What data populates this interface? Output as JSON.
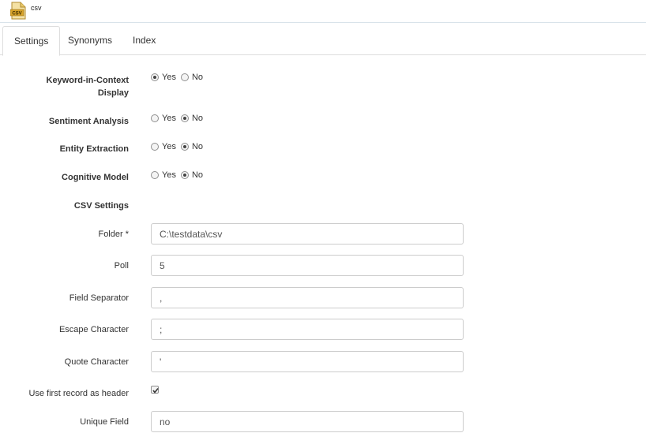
{
  "header": {
    "title": "csv",
    "icon": "csv-file-icon",
    "icon_label": "CSV"
  },
  "tabs": [
    {
      "label": "Settings",
      "active": true
    },
    {
      "label": "Synonyms",
      "active": false
    },
    {
      "label": "Index",
      "active": false
    }
  ],
  "options": {
    "yes_label": "Yes",
    "no_label": "No",
    "keyword_in_context": {
      "label_line1": "Keyword-in-Context",
      "label_line2": "Display",
      "value": "Yes"
    },
    "sentiment_analysis": {
      "label": "Sentiment Analysis",
      "value": "No"
    },
    "entity_extraction": {
      "label": "Entity Extraction",
      "value": "No"
    },
    "cognitive_model": {
      "label": "Cognitive Model",
      "value": "No"
    }
  },
  "csv_settings": {
    "heading": "CSV Settings",
    "folder": {
      "label": "Folder *",
      "value": "C:\\testdata\\csv"
    },
    "poll": {
      "label": "Poll",
      "value": "5"
    },
    "field_separator": {
      "label": "Field Separator",
      "value": ","
    },
    "escape_character": {
      "label": "Escape Character",
      "value": ";"
    },
    "quote_character": {
      "label": "Quote Character",
      "value": "'"
    },
    "use_first_record": {
      "label": "Use first record as header",
      "checked": true
    },
    "unique_field": {
      "label": "Unique Field",
      "value": "no"
    }
  }
}
